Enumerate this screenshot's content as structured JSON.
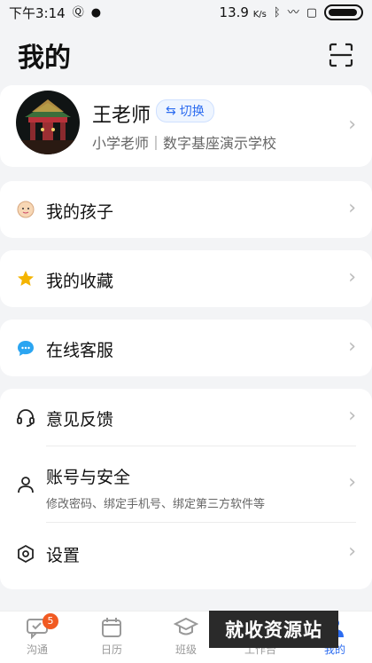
{
  "status_bar": {
    "time": "下午3:14",
    "net_speed": "13.9",
    "net_unit": "K/s",
    "battery": "99"
  },
  "header": {
    "title": "我的"
  },
  "profile": {
    "name": "王老师",
    "switch_label": "切换",
    "subtitle": "小学老师｜数字基座演示学校"
  },
  "menu": {
    "children": "我的孩子",
    "favorites": "我的收藏",
    "support": "在线客服",
    "feedback": "意见反馈",
    "account": "账号与安全",
    "account_sub": "修改密码、绑定手机号、绑定第三方软件等",
    "settings": "设置"
  },
  "tabs": [
    {
      "label": "沟通",
      "badge": "5"
    },
    {
      "label": "日历"
    },
    {
      "label": "班级"
    },
    {
      "label": "工作台"
    },
    {
      "label": "我的"
    }
  ],
  "watermark": "就收资源站",
  "colors": {
    "accent": "#2c6cf0",
    "badge": "#f15a22",
    "background": "#f3f4f6"
  }
}
